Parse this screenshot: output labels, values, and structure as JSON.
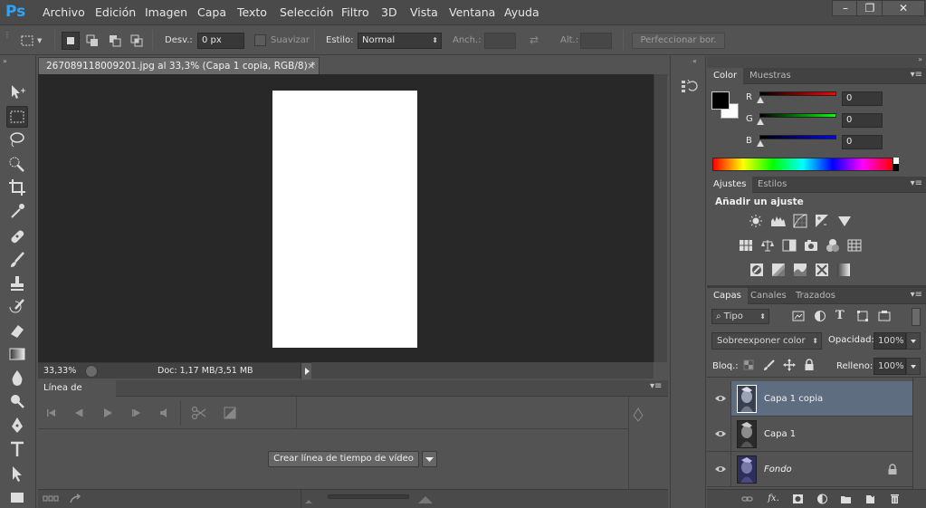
{
  "app": {
    "logo": "Ps"
  },
  "menu": [
    "Archivo",
    "Edición",
    "Imagen",
    "Capa",
    "Texto",
    "Selección",
    "Filtro",
    "3D",
    "Vista",
    "Ventana",
    "Ayuda"
  ],
  "window_controls": {
    "minimize": "–",
    "restore": "❐",
    "close": "✕"
  },
  "options": {
    "feather_label": "Desv.:",
    "feather_value": "0 px",
    "smooth_label": "Suavizar",
    "style_label": "Estilo:",
    "style_value": "Normal",
    "width_label": "Anch.:",
    "height_label": "Alt.:",
    "refine_label": "Perfeccionar bor."
  },
  "document": {
    "tab_title": "267089118009201.jpg al 33,3% (Capa 1 copia, RGB/8) *",
    "close": "×",
    "zoom": "33,33%",
    "doc_info": "Doc: 1,17 MB/3,51 MB"
  },
  "timeline": {
    "tab": "Línea de tiempo",
    "create_button": "Crear línea de tiempo de vídeo"
  },
  "color_panel": {
    "tabs": [
      "Color",
      "Muestras"
    ],
    "r_label": "R",
    "g_label": "G",
    "b_label": "B",
    "r": "0",
    "g": "0",
    "b": "0"
  },
  "adjust_panel": {
    "tabs": [
      "Ajustes",
      "Estilos"
    ],
    "heading": "Añadir un ajuste"
  },
  "layers_panel": {
    "tabs": [
      "Capas",
      "Canales",
      "Trazados"
    ],
    "filter_kind": "Tipo",
    "blend_mode": "Sobreexponer color",
    "opacity_label": "Opacidad:",
    "opacity_value": "100%",
    "lock_label": "Bloq.:",
    "fill_label": "Relleno:",
    "fill_value": "100%",
    "layers": [
      {
        "name": "Capa 1 copia",
        "selected": true
      },
      {
        "name": "Capa 1",
        "selected": false
      },
      {
        "name": "Fondo",
        "selected": false,
        "locked": true
      }
    ]
  },
  "colors": {
    "accent_logo": "#2fa3f5",
    "selected_layer": "#5e6d80"
  }
}
